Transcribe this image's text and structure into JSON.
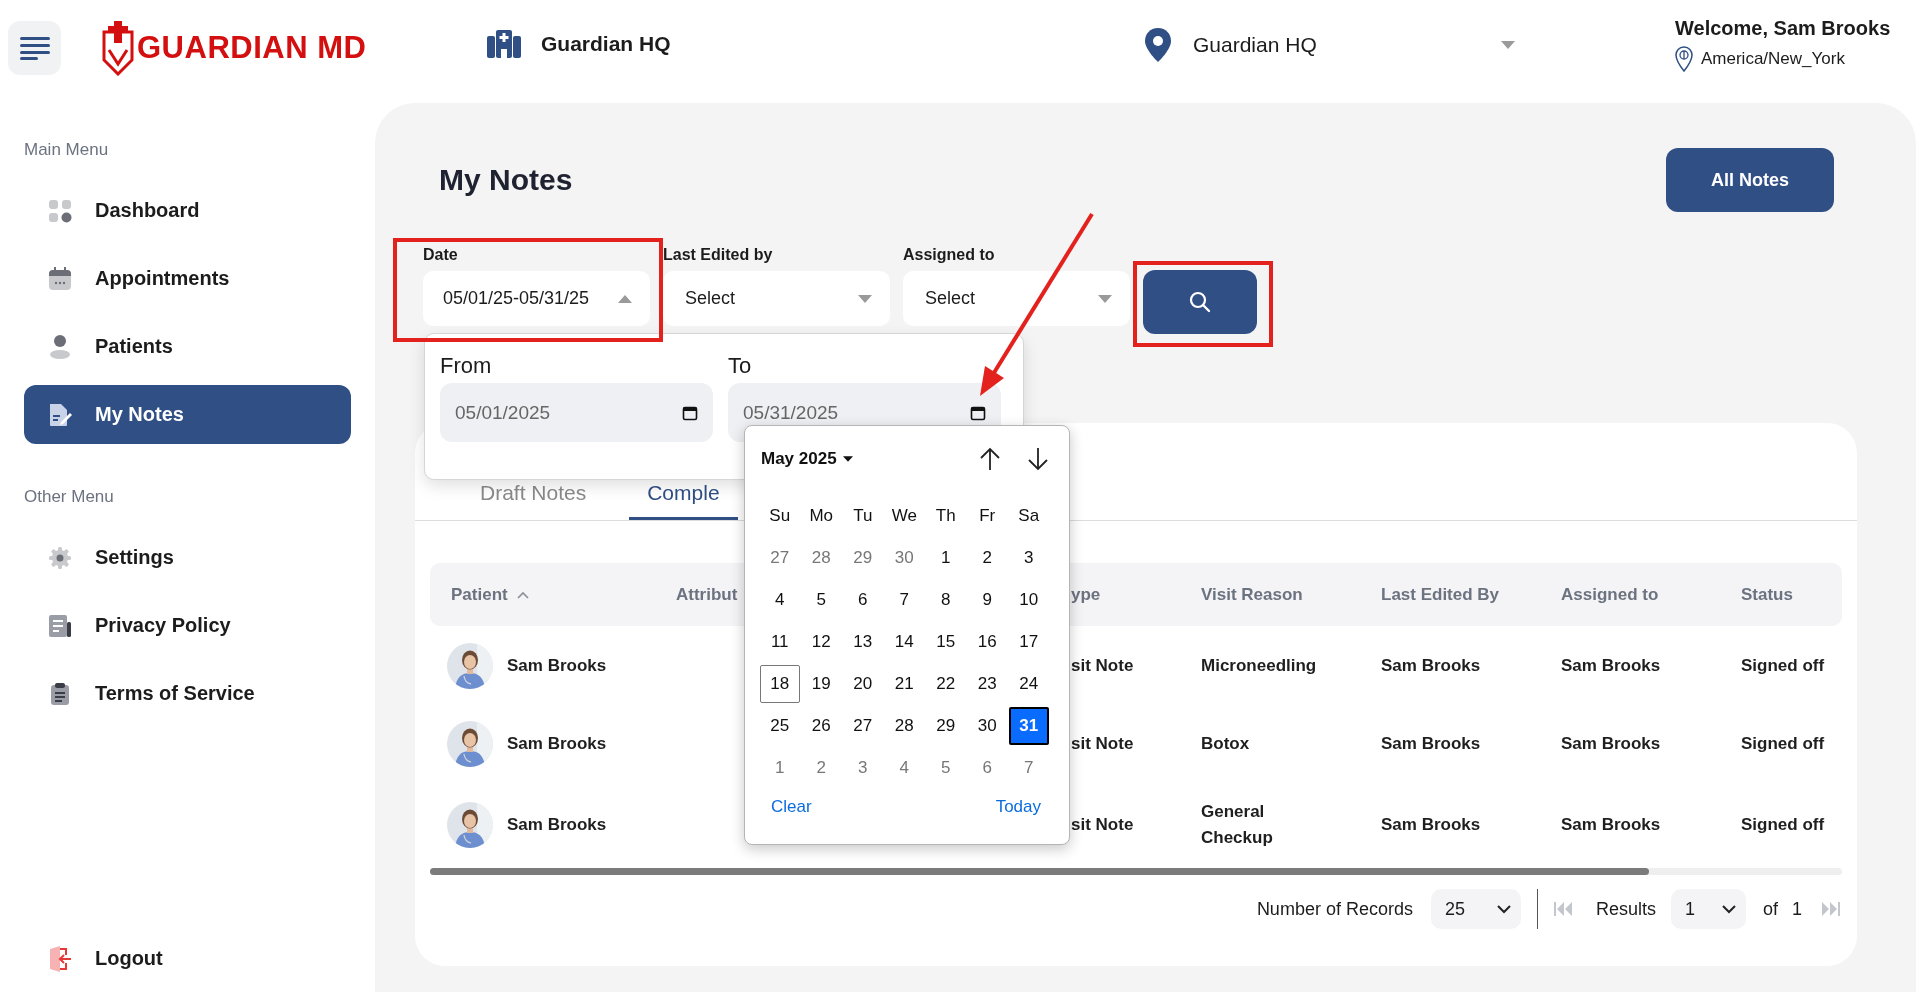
{
  "header": {
    "brand": "GUARDIAN MD",
    "facility": "Guardian HQ",
    "location": "Guardian HQ",
    "welcome": "Welcome, Sam Brooks",
    "timezone": "America/New_York"
  },
  "sidebar": {
    "sections": [
      {
        "title": "Main Menu",
        "items": [
          {
            "label": "Dashboard",
            "selected": false
          },
          {
            "label": "Appointments",
            "selected": false
          },
          {
            "label": "Patients",
            "selected": false
          },
          {
            "label": "My Notes",
            "selected": true
          }
        ]
      },
      {
        "title": "Other Menu",
        "items": [
          {
            "label": "Settings",
            "selected": false
          },
          {
            "label": "Privacy Policy",
            "selected": false
          },
          {
            "label": "Terms of Service",
            "selected": false
          }
        ]
      }
    ],
    "logout": "Logout"
  },
  "page": {
    "title": "My Notes",
    "all_notes_button": "All Notes"
  },
  "filters": [
    {
      "label": "Date",
      "value": "05/01/25-05/31/25",
      "expanded": true
    },
    {
      "label": "Last Edited by",
      "value": "Select",
      "expanded": false
    },
    {
      "label": "Assigned to",
      "value": "Select",
      "expanded": false
    }
  ],
  "date_popup": {
    "from": {
      "label": "From",
      "value": "05/01/2025"
    },
    "to": {
      "label": "To",
      "value": "05/31/2025"
    }
  },
  "calendar": {
    "month": "May 2025",
    "weekdays": [
      "Su",
      "Mo",
      "Tu",
      "We",
      "Th",
      "Fr",
      "Sa"
    ],
    "days": [
      {
        "label": "27",
        "outside": true,
        "today": false,
        "selected": false
      },
      {
        "label": "28",
        "outside": true,
        "today": false,
        "selected": false
      },
      {
        "label": "29",
        "outside": true,
        "today": false,
        "selected": false
      },
      {
        "label": "30",
        "outside": true,
        "today": false,
        "selected": false
      },
      {
        "label": "1",
        "outside": false,
        "today": false,
        "selected": false
      },
      {
        "label": "2",
        "outside": false,
        "today": false,
        "selected": false
      },
      {
        "label": "3",
        "outside": false,
        "today": false,
        "selected": false
      },
      {
        "label": "4",
        "outside": false,
        "today": false,
        "selected": false
      },
      {
        "label": "5",
        "outside": false,
        "today": false,
        "selected": false
      },
      {
        "label": "6",
        "outside": false,
        "today": false,
        "selected": false
      },
      {
        "label": "7",
        "outside": false,
        "today": false,
        "selected": false
      },
      {
        "label": "8",
        "outside": false,
        "today": false,
        "selected": false
      },
      {
        "label": "9",
        "outside": false,
        "today": false,
        "selected": false
      },
      {
        "label": "10",
        "outside": false,
        "today": false,
        "selected": false
      },
      {
        "label": "11",
        "outside": false,
        "today": false,
        "selected": false
      },
      {
        "label": "12",
        "outside": false,
        "today": false,
        "selected": false
      },
      {
        "label": "13",
        "outside": false,
        "today": false,
        "selected": false
      },
      {
        "label": "14",
        "outside": false,
        "today": false,
        "selected": false
      },
      {
        "label": "15",
        "outside": false,
        "today": false,
        "selected": false
      },
      {
        "label": "16",
        "outside": false,
        "today": false,
        "selected": false
      },
      {
        "label": "17",
        "outside": false,
        "today": false,
        "selected": false
      },
      {
        "label": "18",
        "outside": false,
        "today": true,
        "selected": false
      },
      {
        "label": "19",
        "outside": false,
        "today": false,
        "selected": false
      },
      {
        "label": "20",
        "outside": false,
        "today": false,
        "selected": false
      },
      {
        "label": "21",
        "outside": false,
        "today": false,
        "selected": false
      },
      {
        "label": "22",
        "outside": false,
        "today": false,
        "selected": false
      },
      {
        "label": "23",
        "outside": false,
        "today": false,
        "selected": false
      },
      {
        "label": "24",
        "outside": false,
        "today": false,
        "selected": false
      },
      {
        "label": "25",
        "outside": false,
        "today": false,
        "selected": false
      },
      {
        "label": "26",
        "outside": false,
        "today": false,
        "selected": false
      },
      {
        "label": "27",
        "outside": false,
        "today": false,
        "selected": false
      },
      {
        "label": "28",
        "outside": false,
        "today": false,
        "selected": false
      },
      {
        "label": "29",
        "outside": false,
        "today": false,
        "selected": false
      },
      {
        "label": "30",
        "outside": false,
        "today": false,
        "selected": false
      },
      {
        "label": "31",
        "outside": false,
        "today": false,
        "selected": true
      },
      {
        "label": "1",
        "outside": true,
        "today": false,
        "selected": false
      },
      {
        "label": "2",
        "outside": true,
        "today": false,
        "selected": false
      },
      {
        "label": "3",
        "outside": true,
        "today": false,
        "selected": false
      },
      {
        "label": "4",
        "outside": true,
        "today": false,
        "selected": false
      },
      {
        "label": "5",
        "outside": true,
        "today": false,
        "selected": false
      },
      {
        "label": "6",
        "outside": true,
        "today": false,
        "selected": false
      },
      {
        "label": "7",
        "outside": true,
        "today": false,
        "selected": false
      }
    ],
    "clear": "Clear",
    "today_button": "Today"
  },
  "tabs": [
    {
      "label": "Draft Notes",
      "selected": false
    },
    {
      "label": "Comple",
      "selected": true
    }
  ],
  "table": {
    "columns": [
      {
        "label": "Patient",
        "sorted": true
      },
      {
        "label": "Attribut"
      },
      {
        "label": "ype"
      },
      {
        "label": "Visit Reason",
        "sorted": false
      },
      {
        "label": "Last Edited By",
        "sorted": false
      },
      {
        "label": "Assigned to",
        "sorted": false
      },
      {
        "label": "Status",
        "sorted": false
      }
    ],
    "rows": [
      {
        "patient": "Sam Brooks",
        "type": "sit Note",
        "visit_reason": "Microneedling",
        "last_edited_by": "Sam Brooks",
        "assigned_to": "Sam Brooks",
        "status": "Signed off"
      },
      {
        "patient": "Sam Brooks",
        "type": "sit Note",
        "visit_reason": "Botox",
        "last_edited_by": "Sam Brooks",
        "assigned_to": "Sam Brooks",
        "status": "Signed off"
      },
      {
        "patient": "Sam Brooks",
        "type": "sit Note",
        "visit_reason": "General Checkup",
        "last_edited_by": "Sam Brooks",
        "assigned_to": "Sam Brooks",
        "status": "Signed off"
      }
    ]
  },
  "pagination": {
    "records_label": "Number of Records",
    "records_value": "25",
    "results_label": "Results",
    "page_value": "1",
    "of_label": "of",
    "total_pages": "1"
  }
}
